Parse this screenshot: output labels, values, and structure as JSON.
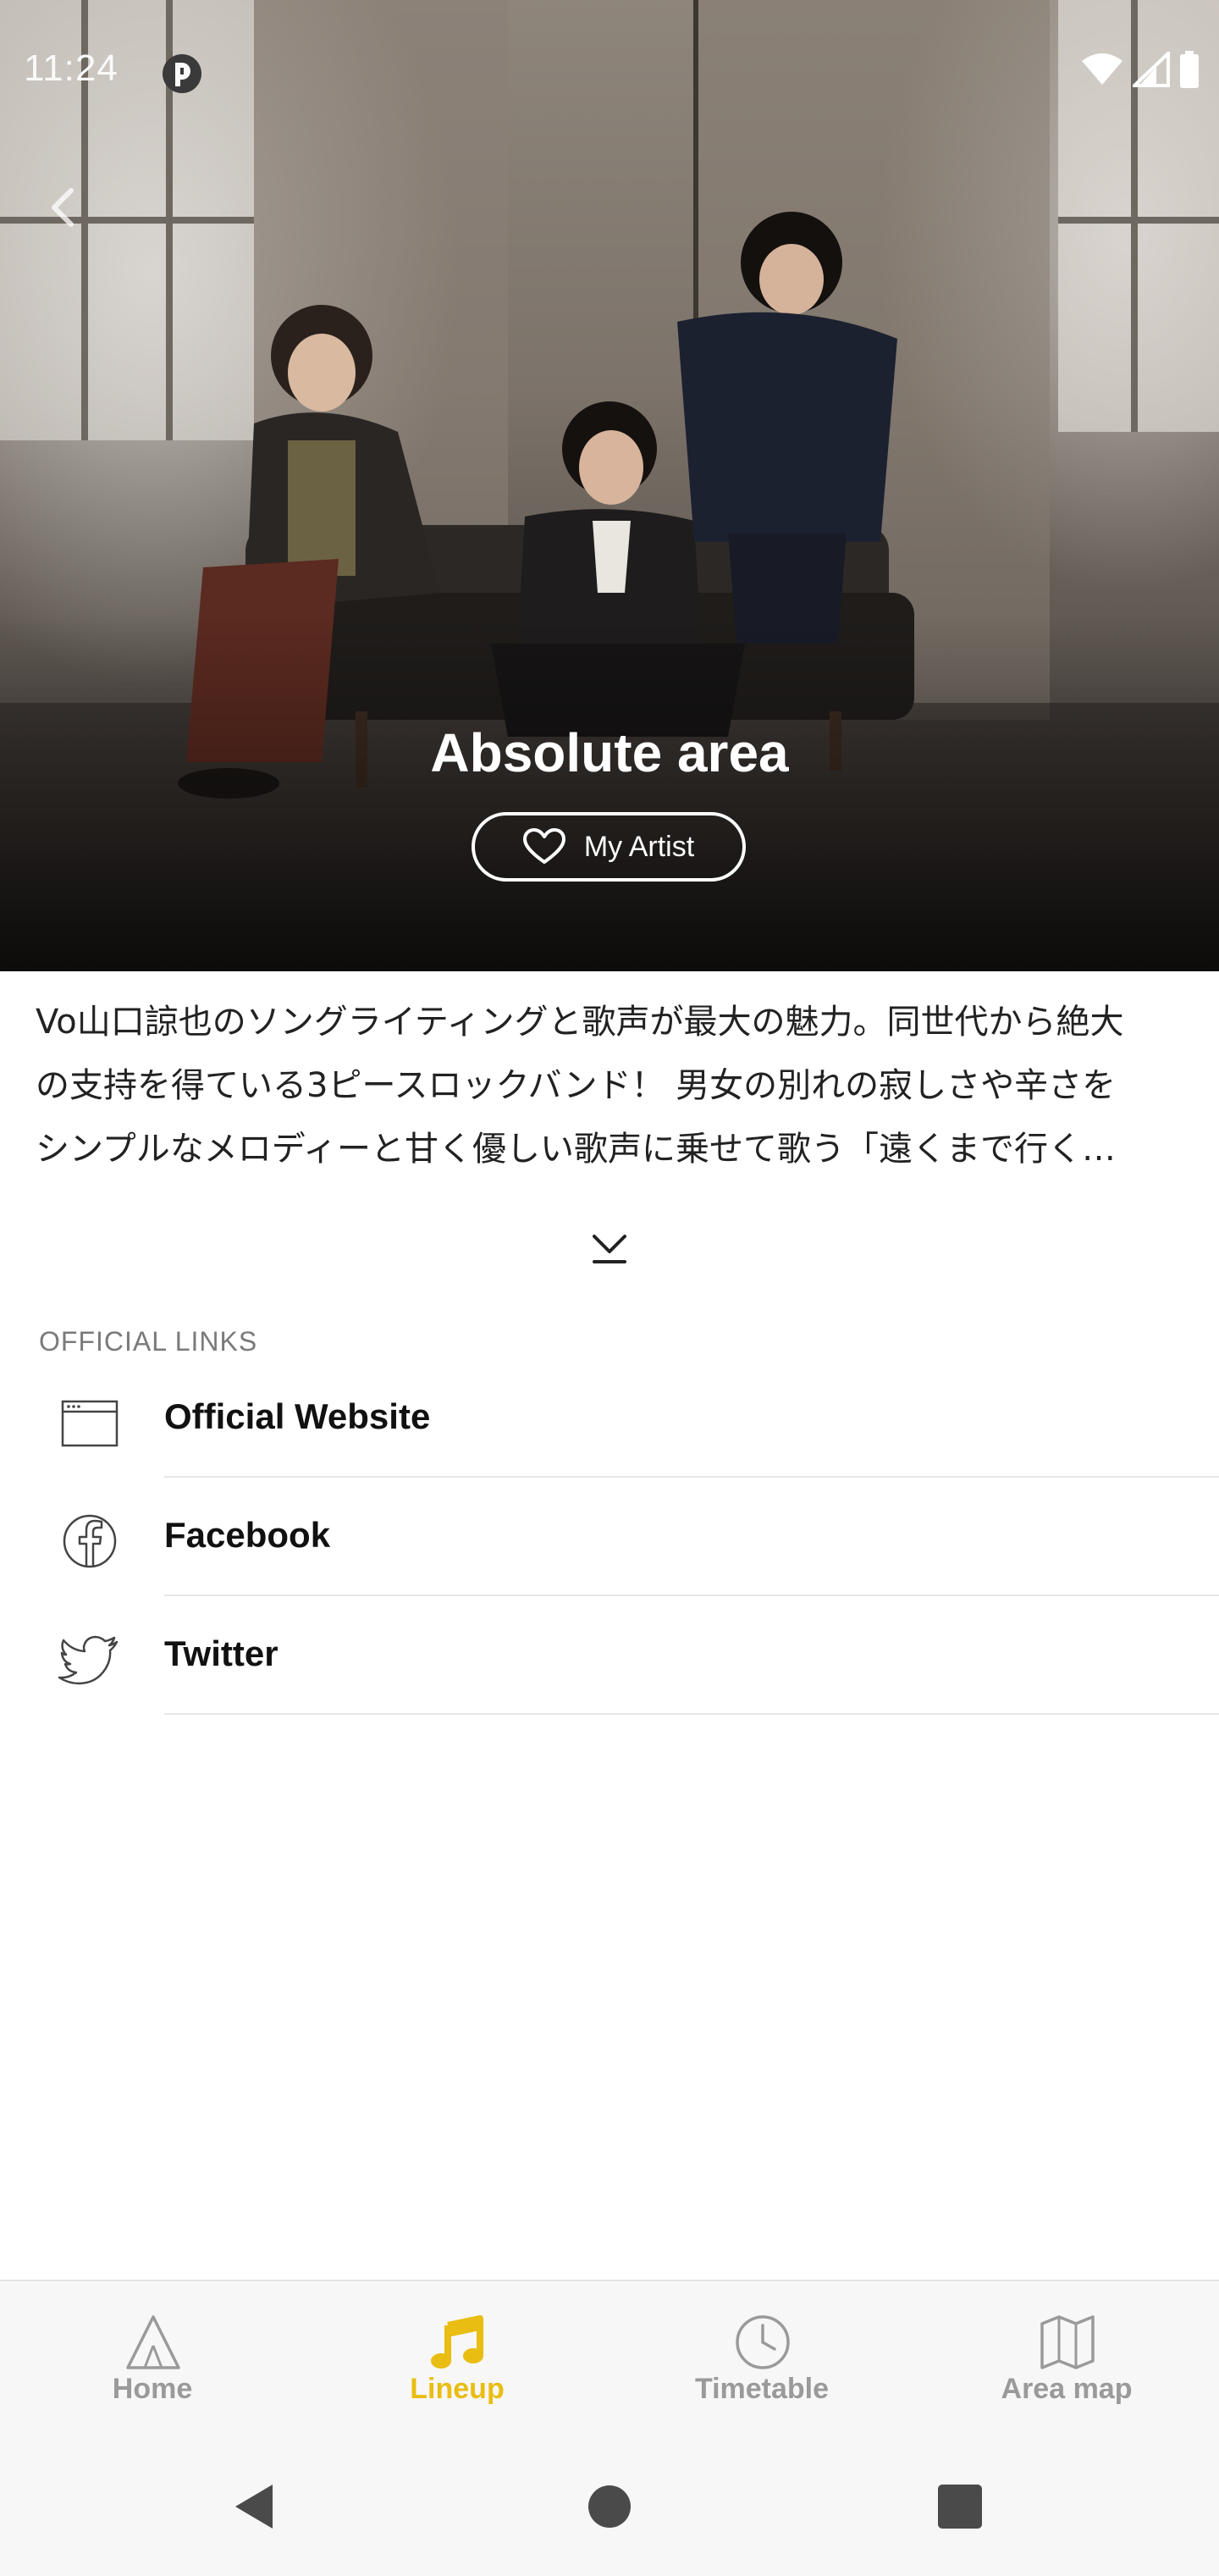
{
  "status_bar": {
    "time": "11:24"
  },
  "artist": {
    "name": "Absolute area",
    "my_artist_label": "My Artist"
  },
  "description": {
    "lines": [
      "Vo山口諒也のソングライティングと歌声が最大の魅力。同世代から絶大",
      "の支持を得ている3ピースロックバンド！ 男女の別れの寂しさや辛さを",
      "シンプルなメロディーと甘く優しい歌声に乗せて歌う「遠くまで行く…"
    ]
  },
  "links": {
    "section_title": "OFFICIAL LINKS",
    "items": [
      {
        "label": "Official Website",
        "icon": "browser-window-icon"
      },
      {
        "label": "Facebook",
        "icon": "facebook-icon"
      },
      {
        "label": "Twitter",
        "icon": "twitter-icon"
      }
    ]
  },
  "bottom_nav": {
    "active_color": "#e9bd12",
    "inactive_color": "#9a9a9a",
    "tabs": [
      {
        "label": "Home",
        "icon": "tent-icon",
        "active": false
      },
      {
        "label": "Lineup",
        "icon": "music-note-icon",
        "active": true
      },
      {
        "label": "Timetable",
        "icon": "clock-icon",
        "active": false
      },
      {
        "label": "Area map",
        "icon": "map-icon",
        "active": false
      }
    ]
  }
}
